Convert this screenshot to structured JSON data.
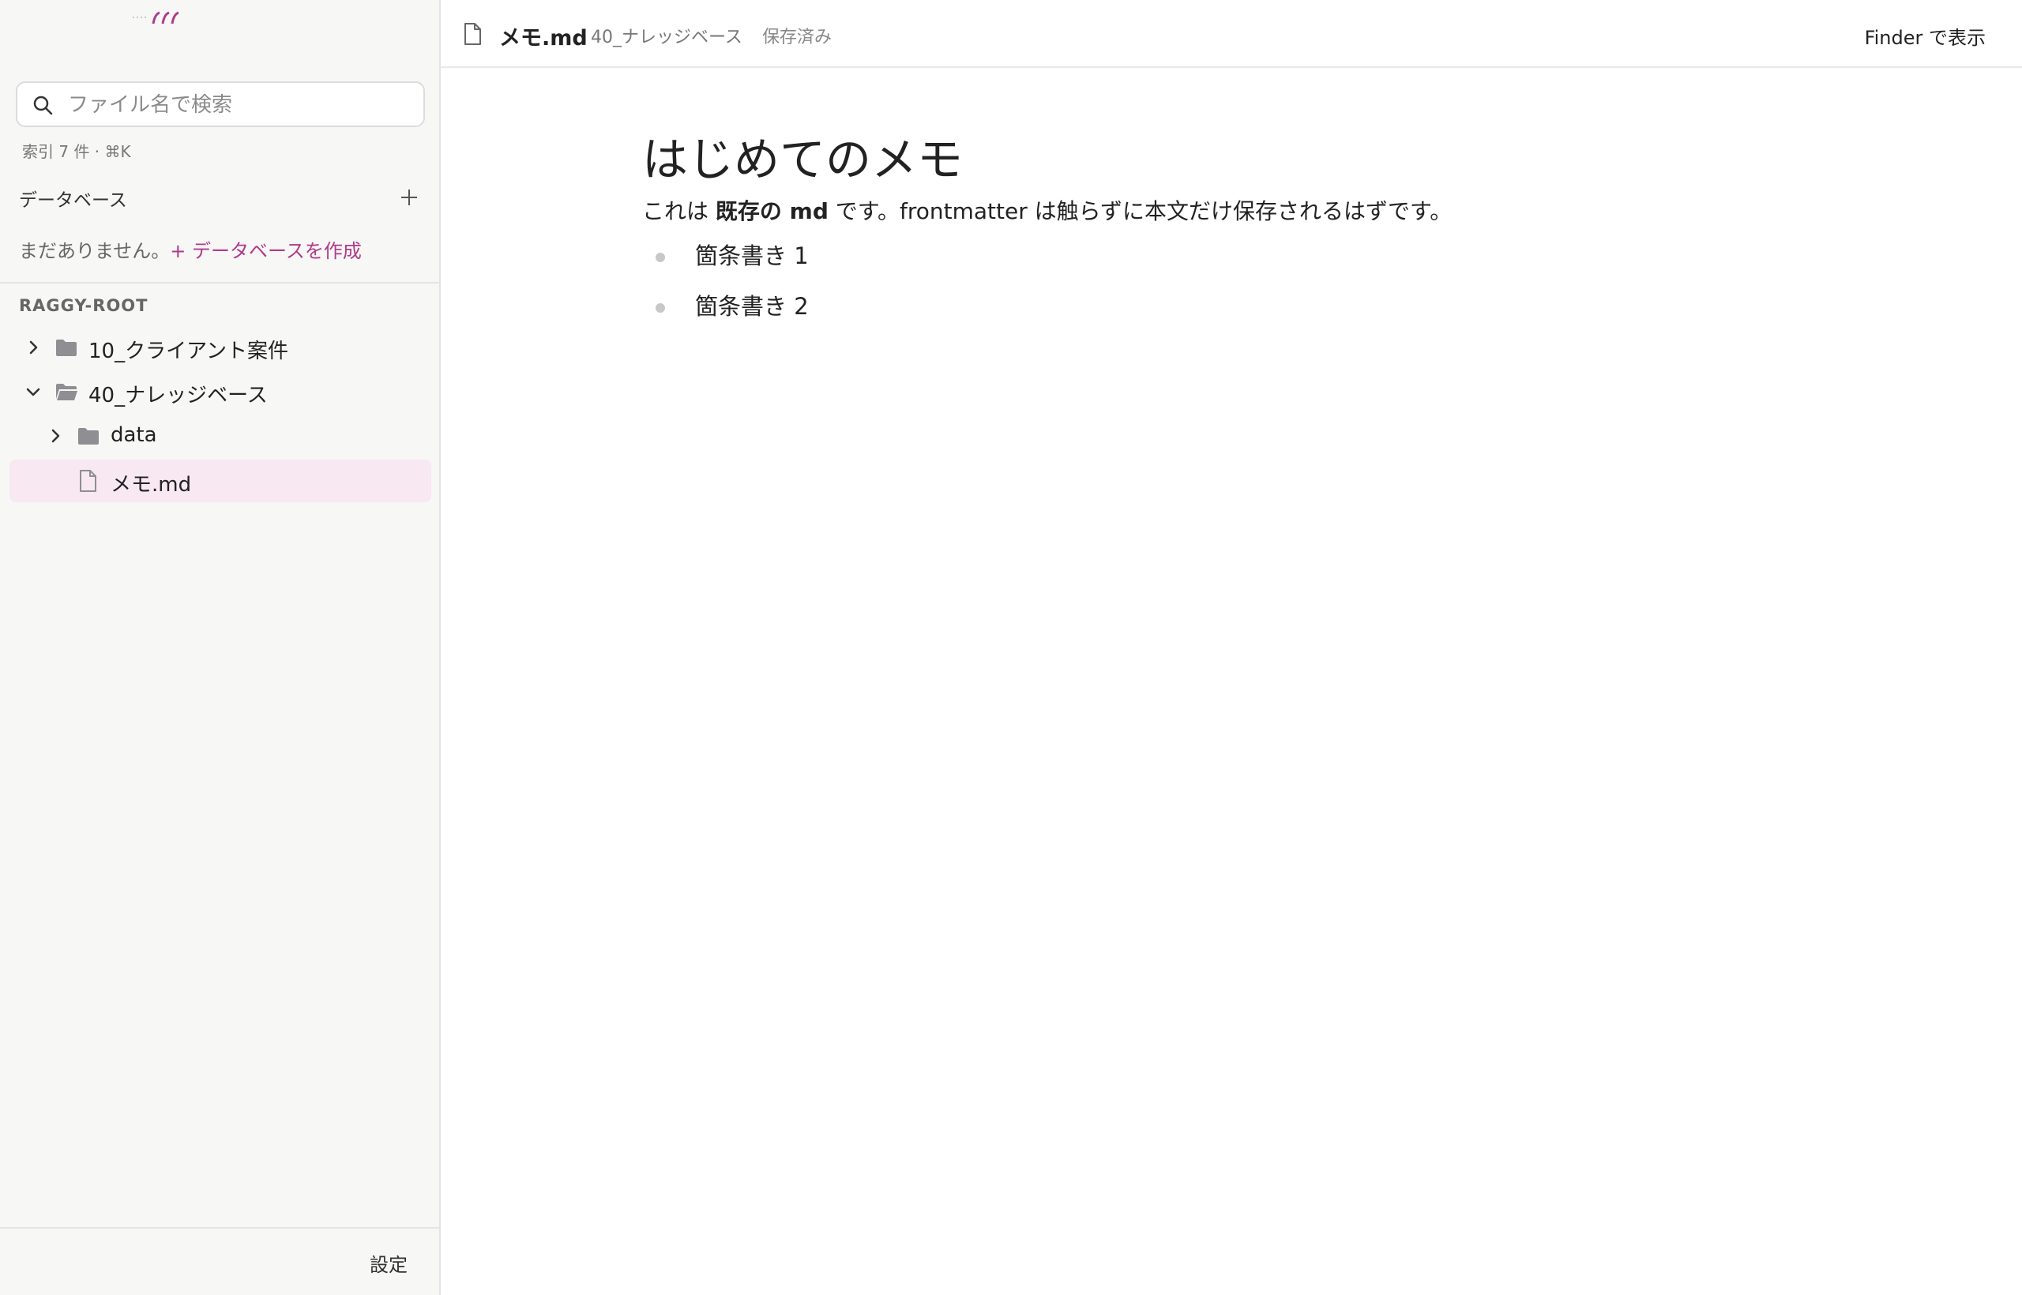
{
  "sidebar": {
    "search": {
      "placeholder": "ファイル名で検索",
      "value": ""
    },
    "index_hint": "索引 7 件 · ⌘K",
    "database": {
      "header": "データベース",
      "empty_text": "まだありません。",
      "create_label": "+ データベースを作成"
    },
    "root_label": "RAGGY-ROOT",
    "tree": [
      {
        "label": "10_クライアント案件",
        "type": "folder",
        "expanded": false
      },
      {
        "label": "40_ナレッジベース",
        "type": "folder",
        "expanded": true
      },
      {
        "label": "data",
        "type": "folder",
        "expanded": false
      },
      {
        "label": "メモ.md",
        "type": "file",
        "selected": true
      }
    ],
    "settings_label": "設定"
  },
  "topbar": {
    "file_name": "メモ.md",
    "path": "40_ナレッジベース",
    "status": "保存済み",
    "finder_label": "Finder で表示"
  },
  "editor": {
    "title": "はじめてのメモ",
    "para_pre": "これは ",
    "para_bold": "既存の md",
    "para_post": " です。frontmatter は触らずに本文だけ保存されるはずです。",
    "bullets": [
      "箇条書き 1",
      "箇条書き 2"
    ]
  },
  "colors": {
    "accent": "#b03a8a",
    "selected_bg": "#f8e8f1",
    "sidebar_bg": "#f7f7f5",
    "folder_icon": "#8e8e93"
  },
  "icons": {
    "logo": "logo-icon",
    "search": "search-icon",
    "add": "plus-icon",
    "folder": "folder-icon",
    "open_folder": "folder-open-icon",
    "file": "file-icon",
    "expand": "chevron-right-icon",
    "collapse": "chevron-down-icon"
  }
}
